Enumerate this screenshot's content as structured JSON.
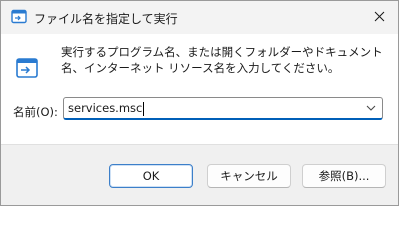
{
  "window": {
    "title": "ファイル名を指定して実行",
    "close_icon": "close-icon"
  },
  "content": {
    "description": "実行するプログラム名、または開くフォルダーやドキュメント名、インターネット リソース名を入力してください。",
    "name_label": "名前(O):",
    "name_value": "services.msc",
    "icon": "run-icon"
  },
  "buttons": {
    "ok": "OK",
    "cancel": "キャンセル",
    "browse": "参照(B)..."
  },
  "colors": {
    "accent": "#005fb8",
    "titlebar": "#f3f3f3",
    "footer": "#f0f0f0"
  }
}
